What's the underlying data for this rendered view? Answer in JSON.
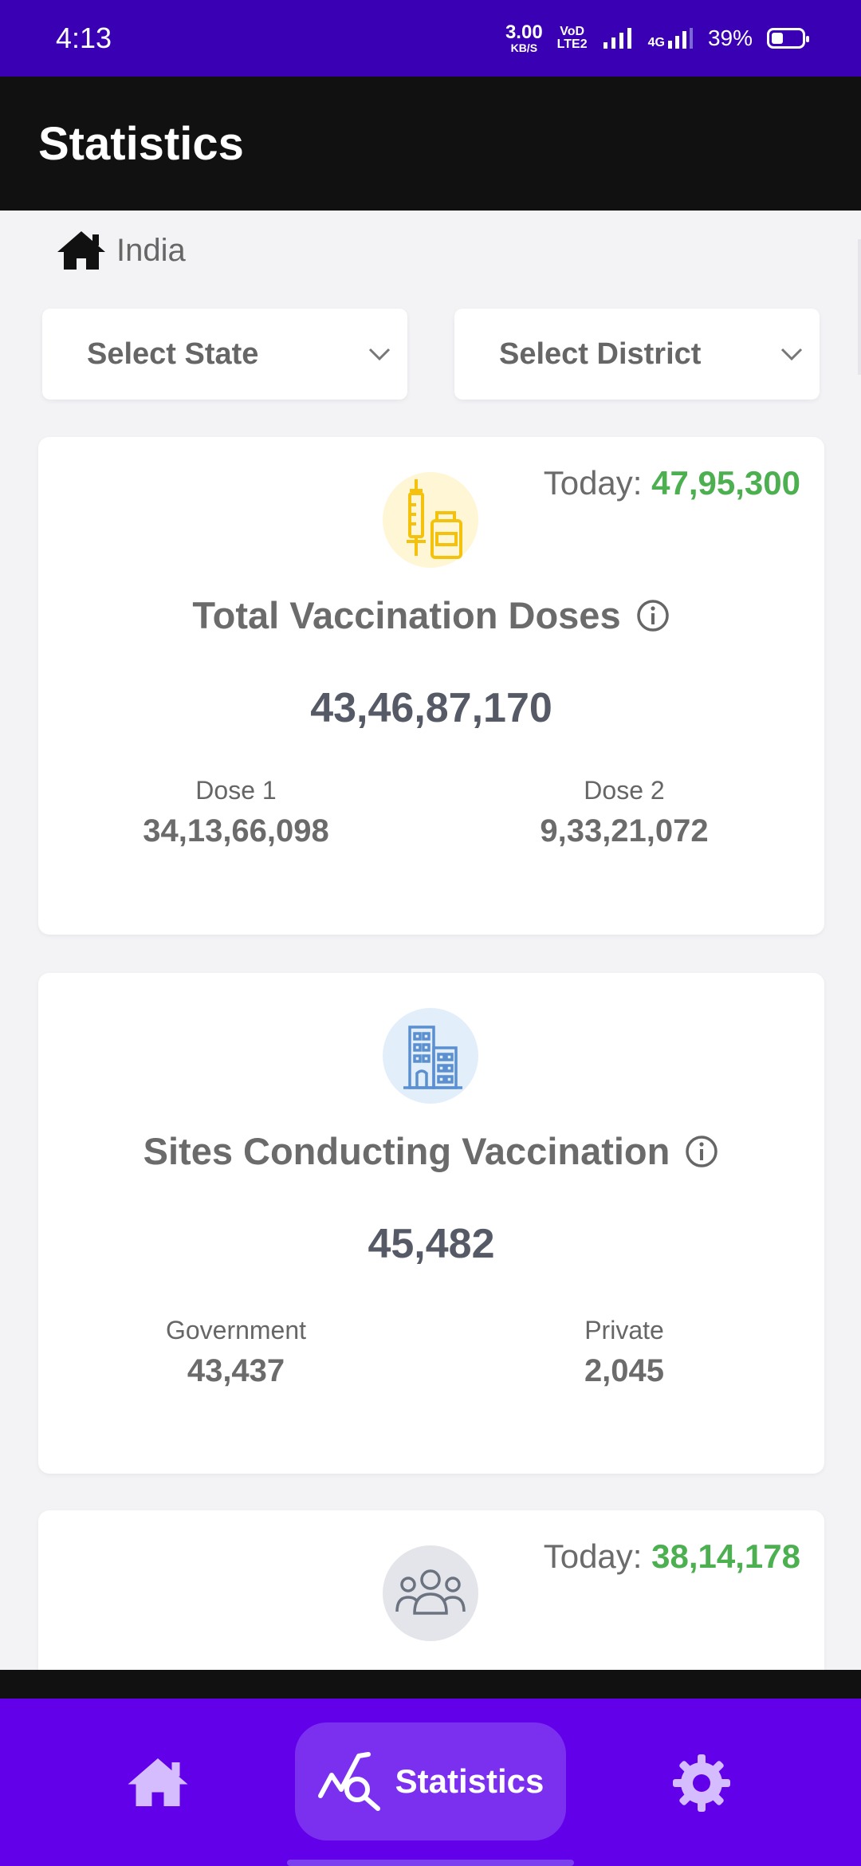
{
  "status_bar": {
    "time": "4:13",
    "net_speed_value": "3.00",
    "net_speed_unit": "KB/S",
    "volte_top": "VoD",
    "volte_bottom": "LTE2",
    "network_4g": "4G",
    "battery": "39%",
    "battery_level": 0.39
  },
  "app_bar": {
    "title": "Statistics"
  },
  "breadcrumb": {
    "label": "India",
    "icon": "home-icon"
  },
  "filters": {
    "state_label": "Select State",
    "district_label": "Select District"
  },
  "cards": [
    {
      "today_label": "Today:",
      "today_value": "47,95,300",
      "icon": "vaccine-vial-icon",
      "title": "Total Vaccination Doses",
      "total": "43,46,87,170",
      "left_label": "Dose 1",
      "left_value": "34,13,66,098",
      "right_label": "Dose 2",
      "right_value": "9,33,21,072"
    },
    {
      "icon": "building-icon",
      "title": "Sites Conducting Vaccination",
      "total": "45,482",
      "left_label": "Government",
      "left_value": "43,437",
      "right_label": "Private",
      "right_value": "2,045"
    },
    {
      "today_label": "Today:",
      "today_value": "38,14,178",
      "icon": "people-group-icon"
    }
  ],
  "bottom_nav": {
    "home_icon": "home-icon",
    "stats_label": "Statistics",
    "settings_icon": "gear-icon"
  },
  "colors": {
    "status_bar": "#3a00b3",
    "app_bar": "#111111",
    "bottom_nav": "#6200ea",
    "today_value": "#4caf50"
  }
}
